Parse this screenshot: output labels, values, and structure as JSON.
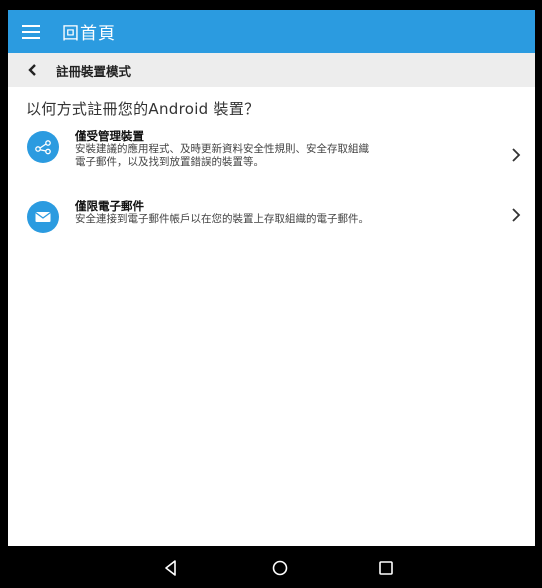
{
  "header": {
    "menu_icon": "hamburger-menu-icon",
    "home_label": "回首頁"
  },
  "subheader": {
    "back_icon": "chevron-left-icon",
    "title": "註冊裝置模式"
  },
  "question": "以何方式註冊您的Android 裝置？",
  "options": [
    {
      "icon": "share-nodes-icon",
      "title": "僅受管理裝置",
      "description_line1": "安裝建議的應用程式、及時更新資料安全性規則、安全存取組織",
      "description_line2": "電子郵件，以及找到放置錯誤的裝置等。",
      "chevron_icon": "chevron-right-icon"
    },
    {
      "icon": "envelope-icon",
      "title": "僅限電子郵件",
      "description_line1": "安全連接到電子郵件帳戶以在您的裝置上存取組織的電子郵件。",
      "chevron_icon": "chevron-right-icon"
    }
  ],
  "navbar": {
    "back_icon": "nav-back-triangle-icon",
    "home_icon": "nav-home-circle-icon",
    "recents_icon": "nav-recents-square-icon"
  },
  "colors": {
    "accent": "#2b9be0",
    "subbar_bg": "#ededed",
    "frame": "#000000"
  }
}
